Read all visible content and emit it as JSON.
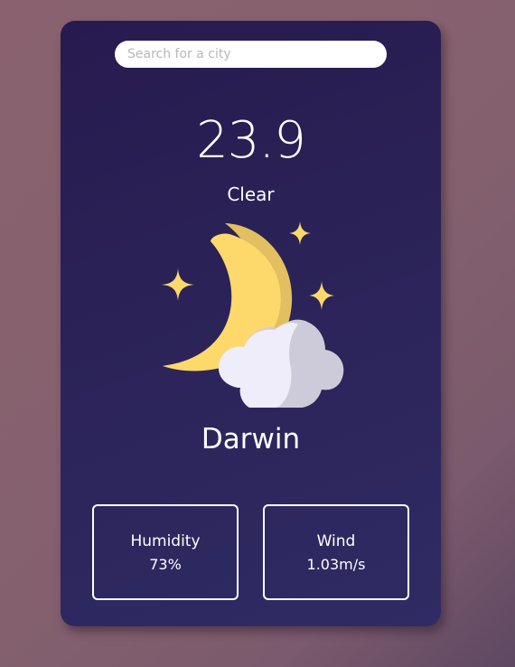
{
  "search": {
    "placeholder": "Search for a city",
    "value": ""
  },
  "weather": {
    "temperature": "23.9",
    "condition": "Clear",
    "city": "Darwin",
    "icon": "moon-clouds-stars-icon"
  },
  "details": {
    "humidity": {
      "label": "Humidity",
      "value": "73%"
    },
    "wind": {
      "label": "Wind",
      "value": "1.03m/s"
    }
  },
  "colors": {
    "background": "#84606e",
    "card": "#2b2358",
    "moon": "#fdd86b",
    "moon_shadow": "#e2bf60",
    "cloud": "#eeedf9",
    "cloud_shadow": "#cdcbd9",
    "star": "#fdd86b"
  }
}
